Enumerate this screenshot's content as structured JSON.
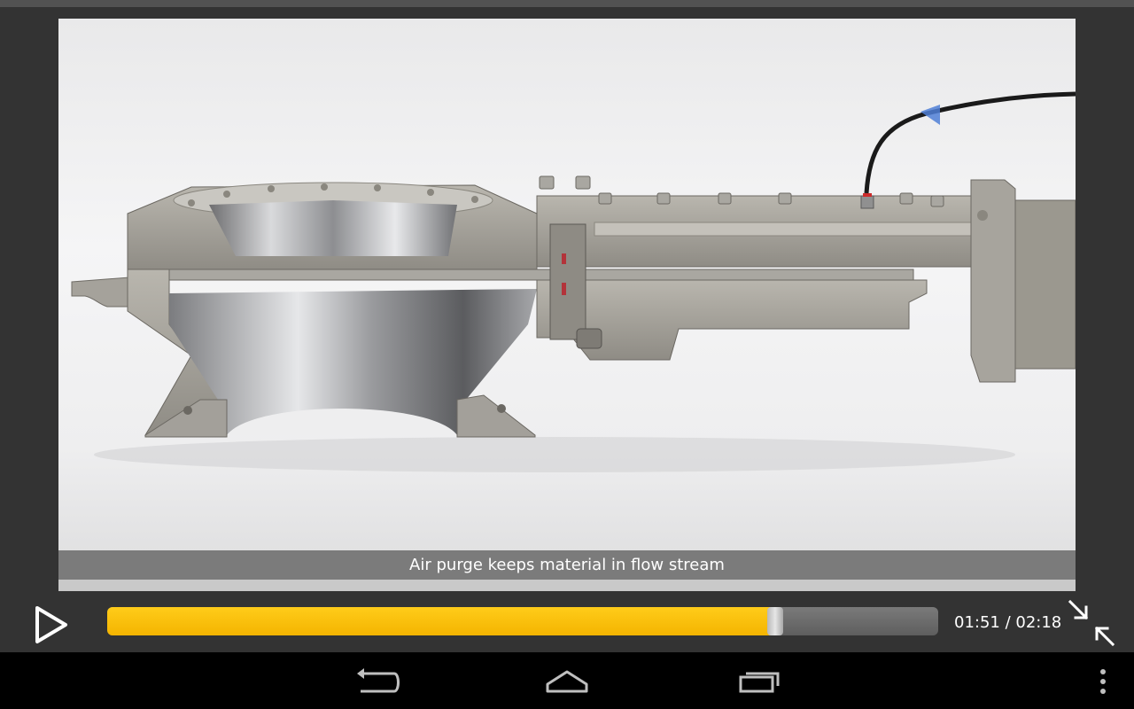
{
  "video": {
    "caption": "Air purge keeps material in flow stream"
  },
  "player": {
    "current_time": "01:51",
    "separator": " / ",
    "total_time": "02:18",
    "progress": 0.804,
    "play_icon": "play-icon",
    "exit_fullscreen_icon": "exit-fullscreen-icon",
    "accent_color": "#f4b400"
  },
  "navbar": {
    "buttons": [
      "back-icon",
      "home-icon",
      "recent-apps-icon",
      "overflow-menu-icon"
    ]
  }
}
